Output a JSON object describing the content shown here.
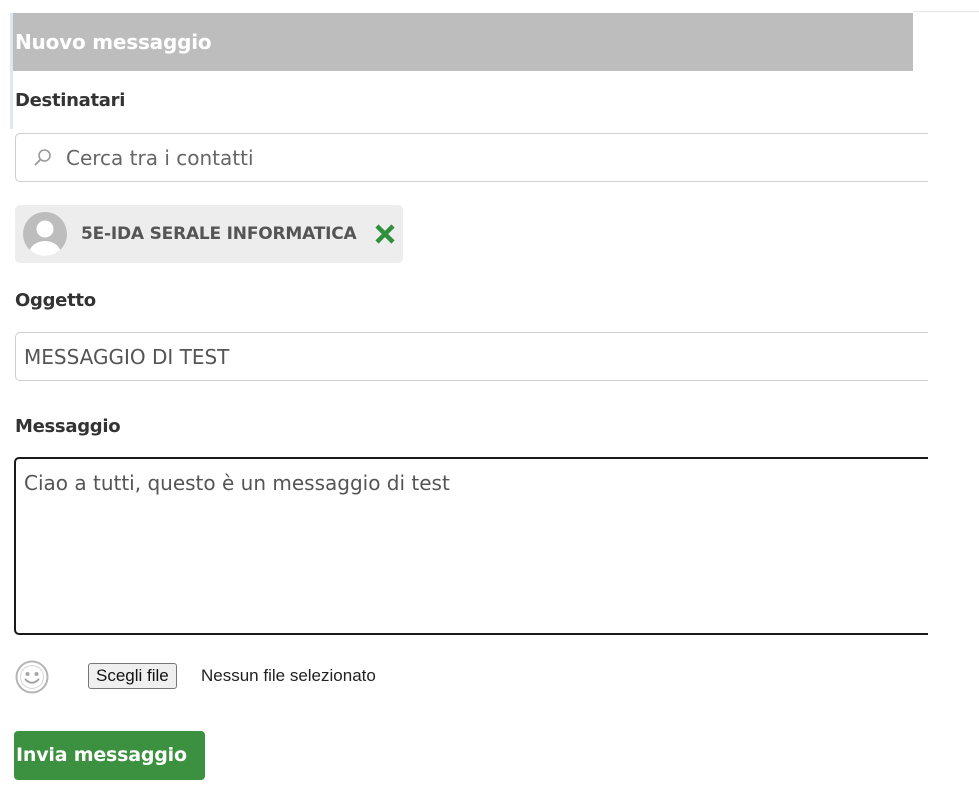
{
  "header": {
    "title": "Nuovo messaggio"
  },
  "recipients": {
    "label": "Destinatari",
    "search_placeholder": "Cerca tra i contatti",
    "search_icon": "search-icon",
    "selected": [
      {
        "name": "5E-IDA SERALE INFORMATICA",
        "avatar_icon": "avatar-placeholder-icon",
        "remove_icon": "close-icon"
      }
    ]
  },
  "subject": {
    "label": "Oggetto",
    "value": "MESSAGGIO DI TEST"
  },
  "message": {
    "label": "Messaggio",
    "value": "Ciao a tutti, questo è un messaggio di test"
  },
  "attachments": {
    "emoji_icon": "smiley-icon",
    "file_button_label": "Scegli file",
    "file_status": "Nessun file selezionato"
  },
  "actions": {
    "send_label": "Invia messaggio"
  },
  "colors": {
    "header_bg": "#bdbdbd",
    "send_button_bg": "#3c9140",
    "remove_icon": "#2f8f3a",
    "chip_bg": "#ededed"
  }
}
